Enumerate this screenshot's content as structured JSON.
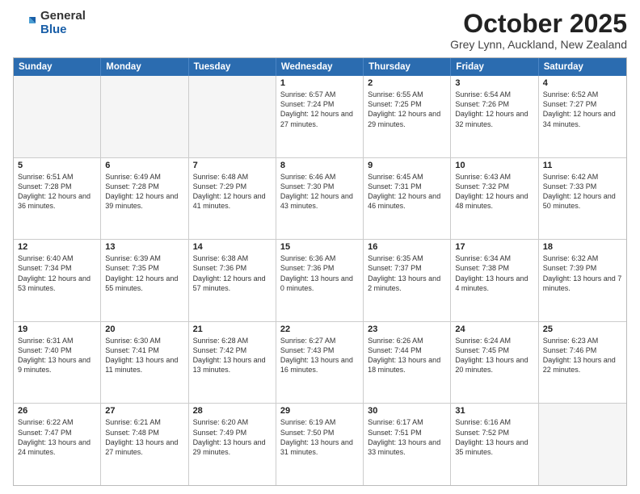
{
  "logo": {
    "general": "General",
    "blue": "Blue"
  },
  "title": "October 2025",
  "location": "Grey Lynn, Auckland, New Zealand",
  "days": [
    "Sunday",
    "Monday",
    "Tuesday",
    "Wednesday",
    "Thursday",
    "Friday",
    "Saturday"
  ],
  "rows": [
    [
      {
        "day": "",
        "text": "",
        "empty": true
      },
      {
        "day": "",
        "text": "",
        "empty": true
      },
      {
        "day": "",
        "text": "",
        "empty": true
      },
      {
        "day": "1",
        "text": "Sunrise: 6:57 AM\nSunset: 7:24 PM\nDaylight: 12 hours\nand 27 minutes."
      },
      {
        "day": "2",
        "text": "Sunrise: 6:55 AM\nSunset: 7:25 PM\nDaylight: 12 hours\nand 29 minutes."
      },
      {
        "day": "3",
        "text": "Sunrise: 6:54 AM\nSunset: 7:26 PM\nDaylight: 12 hours\nand 32 minutes."
      },
      {
        "day": "4",
        "text": "Sunrise: 6:52 AM\nSunset: 7:27 PM\nDaylight: 12 hours\nand 34 minutes."
      }
    ],
    [
      {
        "day": "5",
        "text": "Sunrise: 6:51 AM\nSunset: 7:28 PM\nDaylight: 12 hours\nand 36 minutes."
      },
      {
        "day": "6",
        "text": "Sunrise: 6:49 AM\nSunset: 7:28 PM\nDaylight: 12 hours\nand 39 minutes."
      },
      {
        "day": "7",
        "text": "Sunrise: 6:48 AM\nSunset: 7:29 PM\nDaylight: 12 hours\nand 41 minutes."
      },
      {
        "day": "8",
        "text": "Sunrise: 6:46 AM\nSunset: 7:30 PM\nDaylight: 12 hours\nand 43 minutes."
      },
      {
        "day": "9",
        "text": "Sunrise: 6:45 AM\nSunset: 7:31 PM\nDaylight: 12 hours\nand 46 minutes."
      },
      {
        "day": "10",
        "text": "Sunrise: 6:43 AM\nSunset: 7:32 PM\nDaylight: 12 hours\nand 48 minutes."
      },
      {
        "day": "11",
        "text": "Sunrise: 6:42 AM\nSunset: 7:33 PM\nDaylight: 12 hours\nand 50 minutes."
      }
    ],
    [
      {
        "day": "12",
        "text": "Sunrise: 6:40 AM\nSunset: 7:34 PM\nDaylight: 12 hours\nand 53 minutes."
      },
      {
        "day": "13",
        "text": "Sunrise: 6:39 AM\nSunset: 7:35 PM\nDaylight: 12 hours\nand 55 minutes."
      },
      {
        "day": "14",
        "text": "Sunrise: 6:38 AM\nSunset: 7:36 PM\nDaylight: 12 hours\nand 57 minutes."
      },
      {
        "day": "15",
        "text": "Sunrise: 6:36 AM\nSunset: 7:36 PM\nDaylight: 13 hours\nand 0 minutes."
      },
      {
        "day": "16",
        "text": "Sunrise: 6:35 AM\nSunset: 7:37 PM\nDaylight: 13 hours\nand 2 minutes."
      },
      {
        "day": "17",
        "text": "Sunrise: 6:34 AM\nSunset: 7:38 PM\nDaylight: 13 hours\nand 4 minutes."
      },
      {
        "day": "18",
        "text": "Sunrise: 6:32 AM\nSunset: 7:39 PM\nDaylight: 13 hours\nand 7 minutes."
      }
    ],
    [
      {
        "day": "19",
        "text": "Sunrise: 6:31 AM\nSunset: 7:40 PM\nDaylight: 13 hours\nand 9 minutes."
      },
      {
        "day": "20",
        "text": "Sunrise: 6:30 AM\nSunset: 7:41 PM\nDaylight: 13 hours\nand 11 minutes."
      },
      {
        "day": "21",
        "text": "Sunrise: 6:28 AM\nSunset: 7:42 PM\nDaylight: 13 hours\nand 13 minutes."
      },
      {
        "day": "22",
        "text": "Sunrise: 6:27 AM\nSunset: 7:43 PM\nDaylight: 13 hours\nand 16 minutes."
      },
      {
        "day": "23",
        "text": "Sunrise: 6:26 AM\nSunset: 7:44 PM\nDaylight: 13 hours\nand 18 minutes."
      },
      {
        "day": "24",
        "text": "Sunrise: 6:24 AM\nSunset: 7:45 PM\nDaylight: 13 hours\nand 20 minutes."
      },
      {
        "day": "25",
        "text": "Sunrise: 6:23 AM\nSunset: 7:46 PM\nDaylight: 13 hours\nand 22 minutes."
      }
    ],
    [
      {
        "day": "26",
        "text": "Sunrise: 6:22 AM\nSunset: 7:47 PM\nDaylight: 13 hours\nand 24 minutes."
      },
      {
        "day": "27",
        "text": "Sunrise: 6:21 AM\nSunset: 7:48 PM\nDaylight: 13 hours\nand 27 minutes."
      },
      {
        "day": "28",
        "text": "Sunrise: 6:20 AM\nSunset: 7:49 PM\nDaylight: 13 hours\nand 29 minutes."
      },
      {
        "day": "29",
        "text": "Sunrise: 6:19 AM\nSunset: 7:50 PM\nDaylight: 13 hours\nand 31 minutes."
      },
      {
        "day": "30",
        "text": "Sunrise: 6:17 AM\nSunset: 7:51 PM\nDaylight: 13 hours\nand 33 minutes."
      },
      {
        "day": "31",
        "text": "Sunrise: 6:16 AM\nSunset: 7:52 PM\nDaylight: 13 hours\nand 35 minutes."
      },
      {
        "day": "",
        "text": "",
        "empty": true
      }
    ]
  ]
}
